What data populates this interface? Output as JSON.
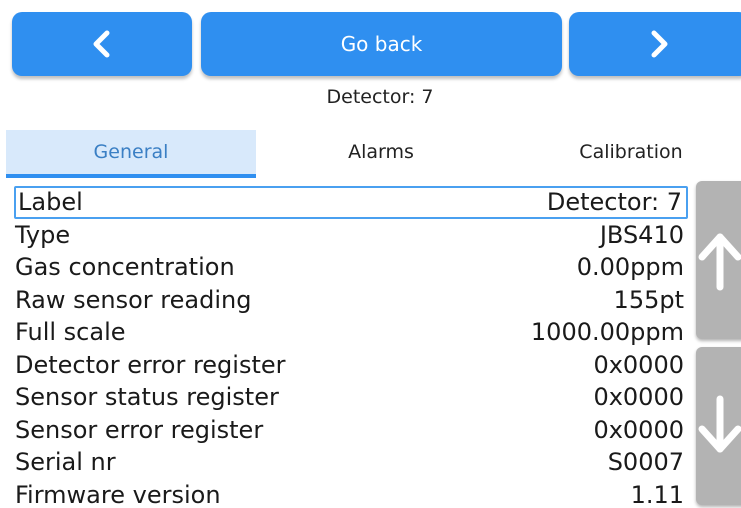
{
  "nav": {
    "prev_icon": "chevron-left-icon",
    "back_label": "Go back",
    "next_icon": "chevron-right-icon"
  },
  "subtitle": "Detector: 7",
  "tabs": [
    {
      "label": "General",
      "active": true
    },
    {
      "label": "Alarms",
      "active": false
    },
    {
      "label": "Calibration",
      "active": false
    }
  ],
  "rows": [
    {
      "label": "Label",
      "value": "Detector: 7",
      "selected": true
    },
    {
      "label": "Type",
      "value": "JBS410"
    },
    {
      "label": "Gas concentration",
      "value": "0.00ppm"
    },
    {
      "label": "Raw sensor reading",
      "value": "155pt"
    },
    {
      "label": "Full scale",
      "value": "1000.00ppm"
    },
    {
      "label": "Detector error register",
      "value": "0x0000"
    },
    {
      "label": "Sensor status register",
      "value": "0x0000"
    },
    {
      "label": "Sensor error register",
      "value": "0x0000"
    },
    {
      "label": "Serial nr",
      "value": "S0007"
    },
    {
      "label": "Firmware version",
      "value": "1.11"
    }
  ],
  "scroll": {
    "up_icon": "arrow-up-icon",
    "down_icon": "arrow-down-icon"
  },
  "colors": {
    "primary": "#2f8ff0",
    "tab_active_bg": "#d8e9fb",
    "tab_active_text": "#3a7fc4",
    "scroll_bg": "#b3b3b3"
  }
}
